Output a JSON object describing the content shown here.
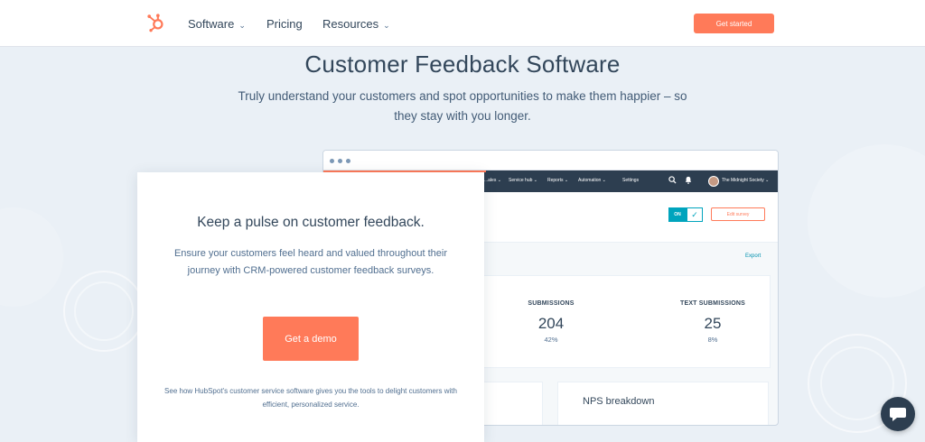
{
  "nav": {
    "items": [
      {
        "label": "Software",
        "has_dropdown": true
      },
      {
        "label": "Pricing",
        "has_dropdown": false
      },
      {
        "label": "Resources",
        "has_dropdown": true
      }
    ],
    "cta_label": "Get started",
    "dropdown_glyph": "⌄",
    "logo_icon": "hubspot-sprocket-icon"
  },
  "hero": {
    "title": "Customer Feedback Software",
    "subtitle": "Truly understand your customers and spot opportunities to make them happier – so they stay with you longer."
  },
  "app_mock": {
    "navbar": {
      "items": [
        "...ales ⌄",
        "Service hub ⌄",
        "Reports ⌄",
        "Automation ⌄",
        "Settings"
      ],
      "account_label": "The Midnight Society ⌄"
    },
    "toggle_label": "ON",
    "toggle_check": "✓",
    "edit_label": "Edit survey",
    "export_label": "Export",
    "stats": [
      {
        "label": "SUBMISSIONS",
        "value": "204",
        "percent": "42%"
      },
      {
        "label": "TEXT SUBMISSIONS",
        "value": "25",
        "percent": "8%"
      }
    ],
    "nps_title": "NPS breakdown"
  },
  "card": {
    "heading": "Keep a pulse on customer feedback.",
    "body": "Ensure your customers feel heard and valued throughout their journey with CRM-powered customer feedback surveys.",
    "cta_label": "Get a demo",
    "footnote": "See how HubSpot's customer service software gives you the tools to delight customers with efficient, personalized service."
  },
  "colors": {
    "accent": "#ff7a59",
    "navy": "#2d3e50",
    "teal": "#00a4bd",
    "background": "#eaf0f6"
  }
}
